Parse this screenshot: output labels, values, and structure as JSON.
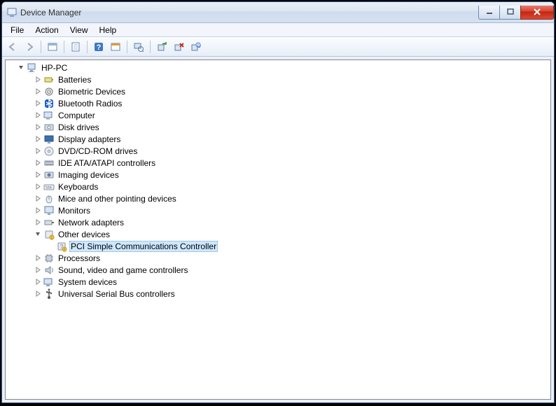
{
  "window": {
    "title": "Device Manager"
  },
  "menu": {
    "file": "File",
    "action": "Action",
    "view": "View",
    "help": "Help"
  },
  "root": {
    "label": "HP-PC"
  },
  "categories": [
    {
      "label": "Batteries",
      "icon": "battery"
    },
    {
      "label": "Biometric Devices",
      "icon": "biometric"
    },
    {
      "label": "Bluetooth Radios",
      "icon": "bluetooth"
    },
    {
      "label": "Computer",
      "icon": "computer"
    },
    {
      "label": "Disk drives",
      "icon": "disk"
    },
    {
      "label": "Display adapters",
      "icon": "display"
    },
    {
      "label": "DVD/CD-ROM drives",
      "icon": "dvd"
    },
    {
      "label": "IDE ATA/ATAPI controllers",
      "icon": "ide"
    },
    {
      "label": "Imaging devices",
      "icon": "imaging"
    },
    {
      "label": "Keyboards",
      "icon": "keyboard"
    },
    {
      "label": "Mice and other pointing devices",
      "icon": "mouse"
    },
    {
      "label": "Monitors",
      "icon": "monitor"
    },
    {
      "label": "Network adapters",
      "icon": "network"
    },
    {
      "label": "Other devices",
      "icon": "other",
      "expanded": true,
      "children": [
        {
          "label": "PCI Simple Communications Controller",
          "icon": "unknown",
          "selected": true
        }
      ]
    },
    {
      "label": "Processors",
      "icon": "processor"
    },
    {
      "label": "Sound, video and game controllers",
      "icon": "sound"
    },
    {
      "label": "System devices",
      "icon": "system"
    },
    {
      "label": "Universal Serial Bus controllers",
      "icon": "usb"
    }
  ]
}
